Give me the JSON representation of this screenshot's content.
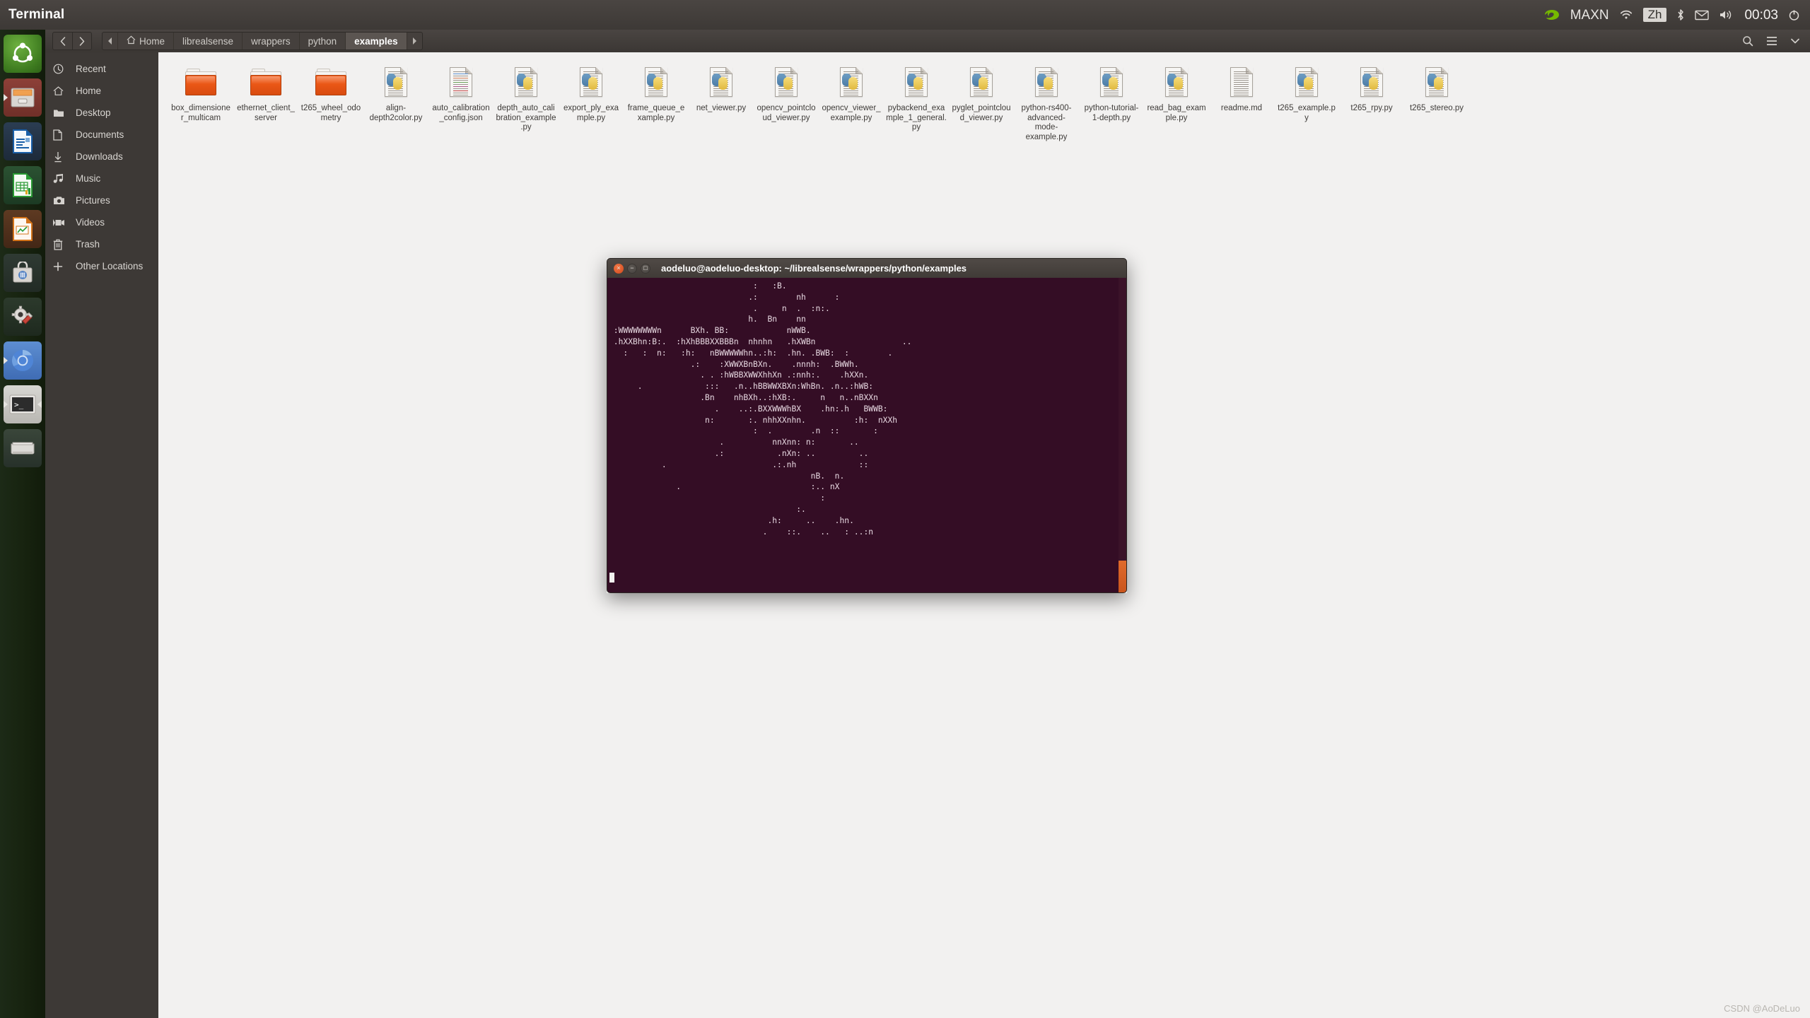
{
  "top_panel": {
    "app_title": "Terminal",
    "tray": {
      "gpu_icon": "nvidia-icon",
      "power_mode": "MAXN",
      "wifi_icon": "wifi-icon",
      "input_method": "Zh",
      "bluetooth_icon": "bluetooth-icon",
      "mail_icon": "mail-icon",
      "volume_icon": "volume-icon",
      "clock": "00:03",
      "power_icon": "power-icon"
    }
  },
  "launcher": {
    "items": [
      {
        "name": "ubuntu-dash",
        "label": "Ubuntu Dash",
        "running": false
      },
      {
        "name": "files",
        "label": "Files",
        "running": true
      },
      {
        "name": "libreoffice-writer",
        "label": "LibreOffice Writer",
        "running": false
      },
      {
        "name": "libreoffice-calc",
        "label": "LibreOffice Calc",
        "running": false
      },
      {
        "name": "libreoffice-impress",
        "label": "LibreOffice Impress",
        "running": false
      },
      {
        "name": "software-center",
        "label": "Ubuntu Software",
        "running": false
      },
      {
        "name": "system-settings",
        "label": "System Settings",
        "running": false
      },
      {
        "name": "chromium",
        "label": "Chromium",
        "running": true
      },
      {
        "name": "terminal",
        "label": "Terminal",
        "running": true,
        "focused": true
      },
      {
        "name": "disk",
        "label": "Disk",
        "running": false
      }
    ]
  },
  "file_manager": {
    "nav": {
      "back_icon": "chevron-left-icon",
      "forward_icon": "chevron-right-icon"
    },
    "breadcrumb": {
      "prev_arrow": "caret-left-icon",
      "next_arrow": "caret-right-icon",
      "crumbs": [
        {
          "label": "Home",
          "icon": "home-icon",
          "active": false
        },
        {
          "label": "librealsense",
          "active": false
        },
        {
          "label": "wrappers",
          "active": false
        },
        {
          "label": "python",
          "active": false
        },
        {
          "label": "examples",
          "active": true
        }
      ]
    },
    "header_actions": [
      {
        "name": "search-icon",
        "label": "Search"
      },
      {
        "name": "view-options-icon",
        "label": "View options"
      },
      {
        "name": "menu-icon",
        "label": "Menu"
      }
    ],
    "sidebar": [
      {
        "label": "Recent",
        "icon": "clock-icon"
      },
      {
        "label": "Home",
        "icon": "home-icon"
      },
      {
        "label": "Desktop",
        "icon": "folder-icon"
      },
      {
        "label": "Documents",
        "icon": "document-icon"
      },
      {
        "label": "Downloads",
        "icon": "download-icon"
      },
      {
        "label": "Music",
        "icon": "music-icon"
      },
      {
        "label": "Pictures",
        "icon": "camera-icon"
      },
      {
        "label": "Videos",
        "icon": "video-icon"
      },
      {
        "label": "Trash",
        "icon": "trash-icon"
      },
      {
        "label": "Other Locations",
        "icon": "plus-icon"
      }
    ],
    "files": [
      {
        "name": "box_dimensioner_multicam",
        "type": "folder"
      },
      {
        "name": "ethernet_client_server",
        "type": "folder"
      },
      {
        "name": "t265_wheel_odometry",
        "type": "folder"
      },
      {
        "name": "align-depth2color.py",
        "type": "python"
      },
      {
        "name": "auto_calibration_config.json",
        "type": "json"
      },
      {
        "name": "depth_auto_calibration_example.py",
        "type": "python"
      },
      {
        "name": "export_ply_example.py",
        "type": "python"
      },
      {
        "name": "frame_queue_example.py",
        "type": "python"
      },
      {
        "name": "net_viewer.py",
        "type": "python"
      },
      {
        "name": "opencv_pointcloud_viewer.py",
        "type": "python"
      },
      {
        "name": "opencv_viewer_example.py",
        "type": "python"
      },
      {
        "name": "pybackend_example_1_general.py",
        "type": "python"
      },
      {
        "name": "pyglet_pointcloud_viewer.py",
        "type": "python"
      },
      {
        "name": "python-rs400-advanced-mode-example.py",
        "type": "python"
      },
      {
        "name": "python-tutorial-1-depth.py",
        "type": "python"
      },
      {
        "name": "read_bag_example.py",
        "type": "python"
      },
      {
        "name": "readme.md",
        "type": "text"
      },
      {
        "name": "t265_example.py",
        "type": "python"
      },
      {
        "name": "t265_rpy.py",
        "type": "python"
      },
      {
        "name": "t265_stereo.py",
        "type": "python"
      }
    ]
  },
  "terminal": {
    "title": "aodeluo@aodeluo-desktop: ~/librealsense/wrappers/python/examples",
    "buttons": {
      "close": "×",
      "minimize": "−",
      "maximize": "□"
    },
    "content": "                              :   :B.\n                             .:        nh      :\n                              .     n  .  :n:.\n                             h.  Bn    nn\n :WWWWWWWWn      BXh. BB:            nWWB.\n .hXXBhn:B:.  :hXhBBBXXBBBn  nhnhn   .hXWBn                  ..\n   :   :  n:   :h:   nBWWWWWhn..:h:  .hn. .BWB:  :        .\n                 .:    :XWWXBnBXn.    .nnnh:  .BWWh.\n                   . . :hWBBXWWXhhXn .:nnh:.    .hXXn.\n      .             :::   .n..hBBWWXBXn:WhBn. .n..:hWB:\n                   .Bn    nhBXh..:hXB:.     n   n..nBXXn\n                      .    ..:.BXXWWWhBX    .hn:.h   BWWB:\n                    n:       :. nhhXXnhn.          :h:  nXXh\n                              :  .        .n  ::       :\n                       .          nnXnn: n:       ..\n                      .:           .nXn: ..         ..\n           .                      .:.nh             ::\n                                          nB.  n.\n              .                           :.. nX\n                                            :\n                                       :.\n                                 .h:     ..    .hn.\n                                .    ::.    ..   : ..:n"
  },
  "watermark": "CSDN @AoDeLuo"
}
